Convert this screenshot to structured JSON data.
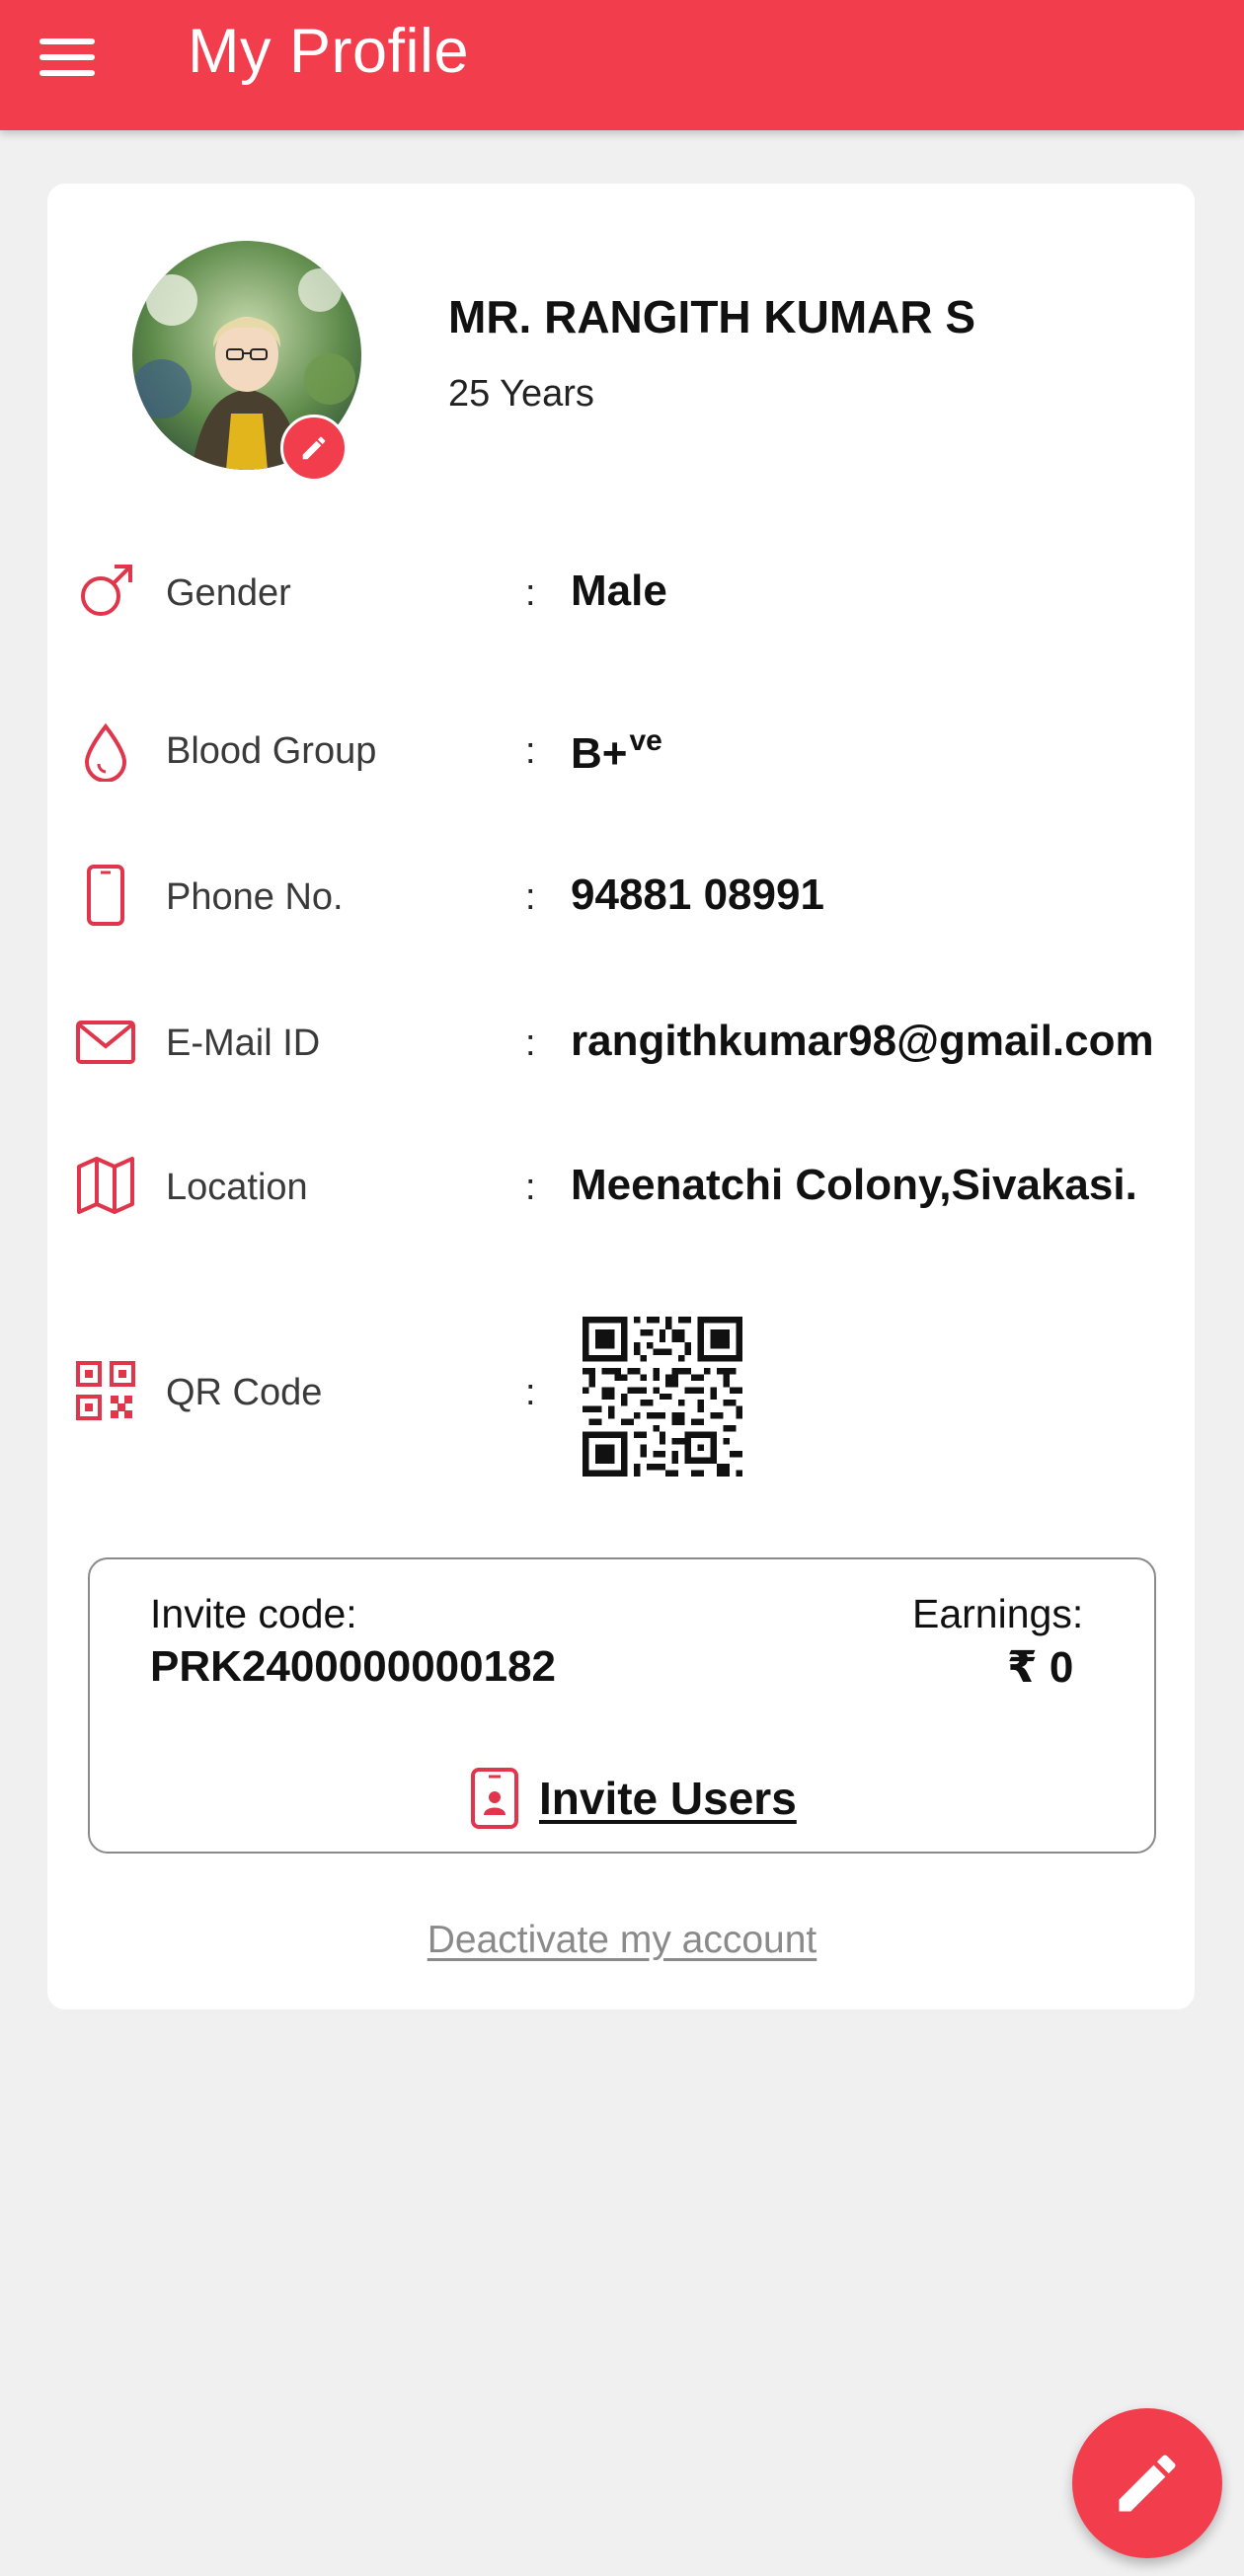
{
  "appbar": {
    "title": "My Profile",
    "menu_icon": "hamburger-menu-icon"
  },
  "profile": {
    "name": "MR. RANGITH KUMAR S",
    "age": "25 Years",
    "avatar_icon": "profile-photo",
    "edit_avatar_icon": "pencil-icon"
  },
  "details": {
    "gender": {
      "label": "Gender",
      "value": "Male",
      "icon": "male-symbol-icon"
    },
    "blood_group": {
      "label": "Blood Group",
      "value": "B+",
      "value_sup": "ve",
      "icon": "blood-drop-icon"
    },
    "phone": {
      "label": "Phone No.",
      "value": "94881 08991",
      "icon": "mobile-phone-icon"
    },
    "email": {
      "label": "E-Mail ID",
      "value": "rangithkumar98@gmail.com",
      "icon": "envelope-icon"
    },
    "location": {
      "label": "Location",
      "value": "Meenatchi Colony,Sivakasi.",
      "icon": "map-icon"
    },
    "qr": {
      "label": "QR Code",
      "icon": "qr-code-icon"
    },
    "separator": ":"
  },
  "invite": {
    "code_label": "Invite code:",
    "code_value": "PRK2400000000182",
    "earnings_label": "Earnings:",
    "earnings_value": "₹ 0",
    "invite_users_label": "Invite Users",
    "invite_icon": "phone-contact-icon"
  },
  "footer": {
    "deactivate_label": "Deactivate my account"
  },
  "fab": {
    "icon": "pencil-icon"
  },
  "colors": {
    "accent": "#f23d4c",
    "background": "#f0f0f1",
    "card": "#ffffff"
  }
}
